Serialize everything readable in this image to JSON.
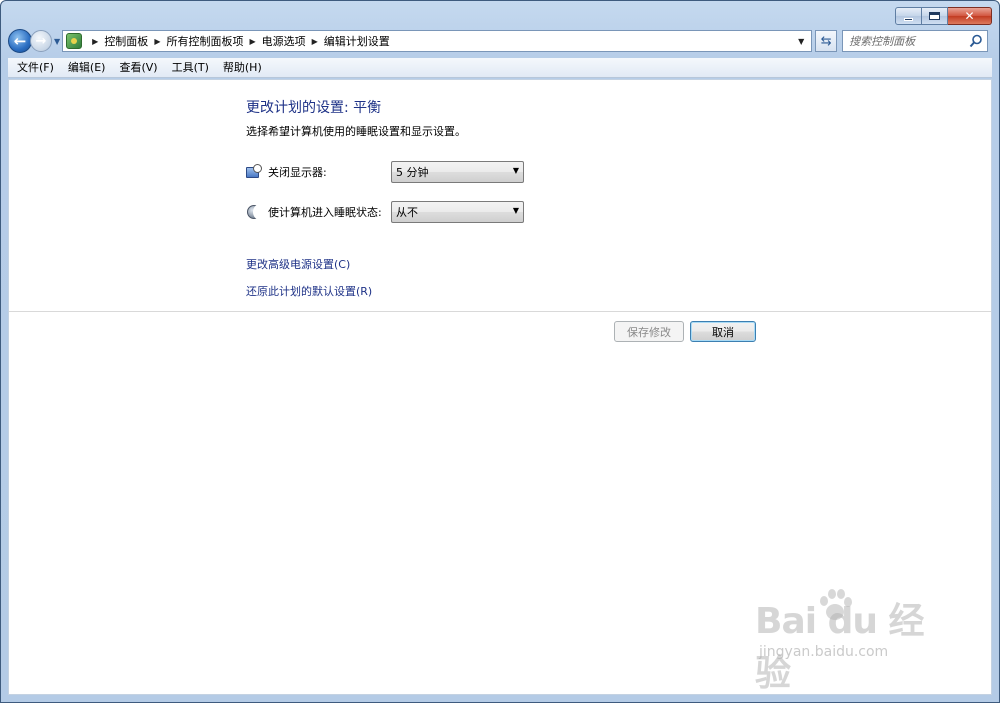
{
  "navbar": {
    "breadcrumbs": [
      "控制面板",
      "所有控制面板项",
      "电源选项",
      "编辑计划设置"
    ],
    "search_placeholder": "搜索控制面板"
  },
  "menu": {
    "items": [
      "文件(F)",
      "编辑(E)",
      "查看(V)",
      "工具(T)",
      "帮助(H)"
    ]
  },
  "main": {
    "title": "更改计划的设置: 平衡",
    "description": "选择希望计算机使用的睡眠设置和显示设置。",
    "settings": [
      {
        "label": "关闭显示器:",
        "value": "5 分钟",
        "icon": "monitor-clock-icon"
      },
      {
        "label": "使计算机进入睡眠状态:",
        "value": "从不",
        "icon": "moon-icon"
      }
    ],
    "links": [
      "更改高级电源设置(C)",
      "还原此计划的默认设置(R)"
    ],
    "buttons": {
      "save": "保存修改",
      "cancel": "取消"
    }
  },
  "watermark": {
    "brand": "Bai du 经验",
    "url": "jingyan.baidu.com"
  },
  "colors": {
    "link": "#1e3287",
    "frame": "#b6cde8"
  }
}
